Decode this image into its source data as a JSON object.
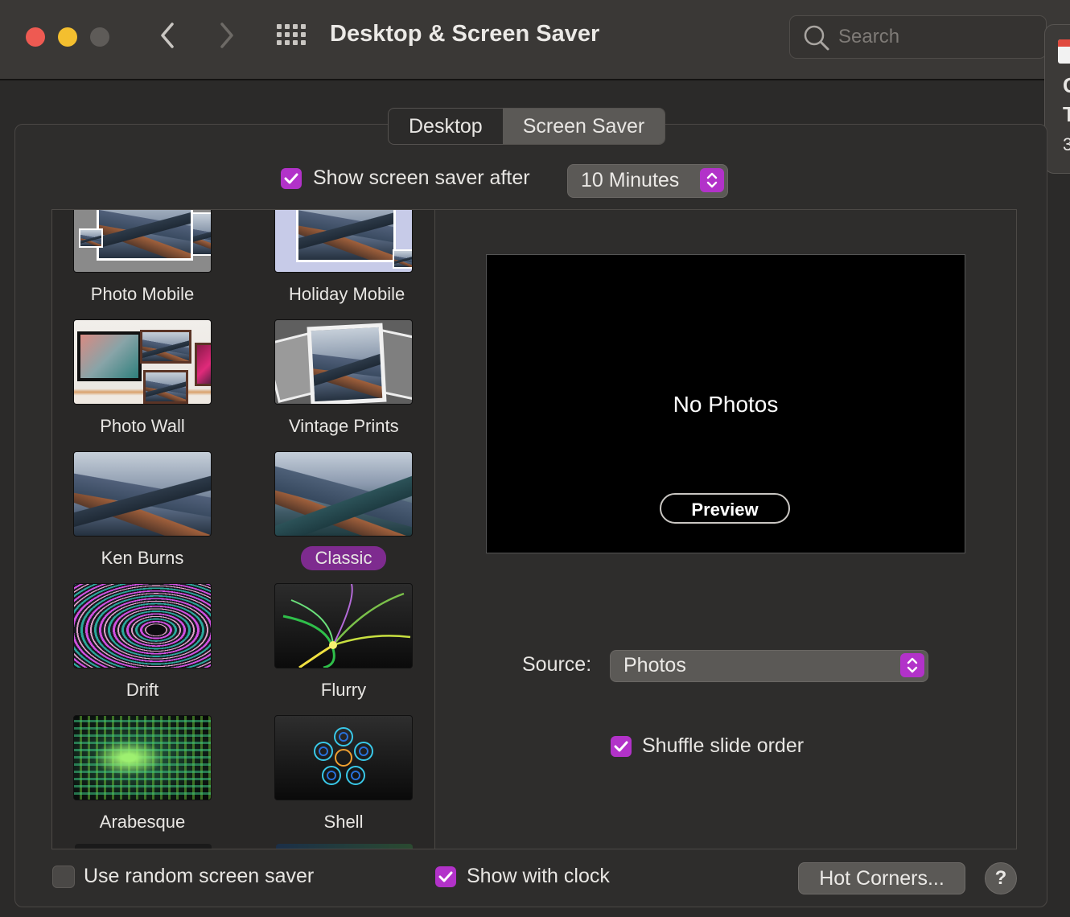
{
  "window": {
    "title": "Desktop & Screen Saver",
    "search_placeholder": "Search"
  },
  "notification": {
    "line1": "C",
    "line2": "T",
    "line3": "3"
  },
  "tabs": [
    {
      "label": "Desktop",
      "selected": false
    },
    {
      "label": "Screen Saver",
      "selected": true
    }
  ],
  "show_after": {
    "label": "Show screen saver after",
    "checked": true,
    "value": "10 Minutes"
  },
  "savers": [
    {
      "name": "Photo Mobile"
    },
    {
      "name": "Holiday Mobile"
    },
    {
      "name": "Photo Wall"
    },
    {
      "name": "Vintage Prints"
    },
    {
      "name": "Ken Burns"
    },
    {
      "name": "Classic",
      "selected": true
    },
    {
      "name": "Drift"
    },
    {
      "name": "Flurry"
    },
    {
      "name": "Arabesque"
    },
    {
      "name": "Shell"
    }
  ],
  "preview": {
    "message": "No Photos",
    "button": "Preview"
  },
  "source": {
    "label": "Source:",
    "value": "Photos"
  },
  "shuffle": {
    "label": "Shuffle slide order",
    "checked": true
  },
  "footer": {
    "random_label": "Use random screen saver",
    "random_checked": false,
    "clock_label": "Show with clock",
    "clock_checked": true,
    "hot_corners": "Hot Corners...",
    "help": "?"
  },
  "colors": {
    "accent": "#b232c9",
    "selection": "#7e2b8f",
    "close": "#ee5a52",
    "minimize": "#f4bf2f",
    "zoom_disabled": "#5e5b58"
  }
}
